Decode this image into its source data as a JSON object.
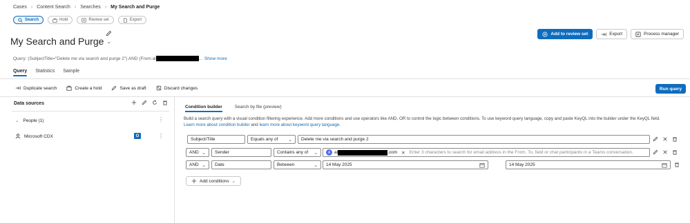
{
  "breadcrumb": {
    "items": [
      "Cases",
      "Content Search",
      "Searches"
    ],
    "current": "My Search and Purge"
  },
  "pills": [
    {
      "label": "Search",
      "icon": "search-icon",
      "active": true
    },
    {
      "label": "Hold",
      "icon": "hold-icon",
      "active": false
    },
    {
      "label": "Review set",
      "icon": "review-set-icon",
      "active": false
    },
    {
      "label": "Export",
      "icon": "export-icon",
      "active": false
    }
  ],
  "page": {
    "title": "My Search and Purge"
  },
  "top_actions": {
    "add_to_review_set": "Add to review set",
    "export": "Export",
    "process_manager": "Process manager"
  },
  "query": {
    "prefix": "Query: (SubjectTitle=\"Delete me via search and purge 2\") AND (From:al",
    "ellipsis": "...",
    "show_more": "Show more"
  },
  "tabs": [
    {
      "label": "Query",
      "active": true
    },
    {
      "label": "Statistics",
      "active": false
    },
    {
      "label": "Sample",
      "active": false
    }
  ],
  "toolbar": {
    "duplicate_search": "Duplicate search",
    "create_hold": "Create a hold",
    "save_as_draft": "Save as draft",
    "discard_changes": "Discard changes",
    "run_query": "Run query"
  },
  "data_sources": {
    "title": "Data sources",
    "group_label": "People (1)",
    "item_label": "Microsoft CDX",
    "item_icon": "outlook-icon"
  },
  "builder": {
    "tabs": [
      {
        "label": "Condition builder",
        "active": true
      },
      {
        "label": "Search by file (preview)",
        "active": false
      }
    ],
    "description": "Build a search query with a visual condition filtering experience. Add more conditions and use operators like AND, OR to control the logic between conditions. To use keyword query language, copy and paste KeyQL into the builder under the KeyQL field.",
    "link1": "Learn more about condition builder",
    "and_text": "and",
    "link2": "learn more about keyword query language."
  },
  "conditions": {
    "row1": {
      "field": "Subject/Title",
      "operator": "Equals any of",
      "value": "Delete me via search and purge 2"
    },
    "row2": {
      "logic": "AND",
      "field": "Sender",
      "operator": "Contains any of",
      "chip_initial": "A",
      "chip_prefix": "al",
      "chip_suffix": ".com",
      "placeholder": "Enter 3 characters to search for email address in the From, To, field or chat participants in a Teams conversation."
    },
    "row3": {
      "logic": "AND",
      "field": "Date",
      "operator": "Between",
      "start_date": "14 May 2025",
      "end_date": "14 May 2025"
    },
    "add_conditions": "Add conditions"
  },
  "colors": {
    "accent": "#0f6cbd",
    "border": "#8a8a8a",
    "redaction": "#000000"
  }
}
